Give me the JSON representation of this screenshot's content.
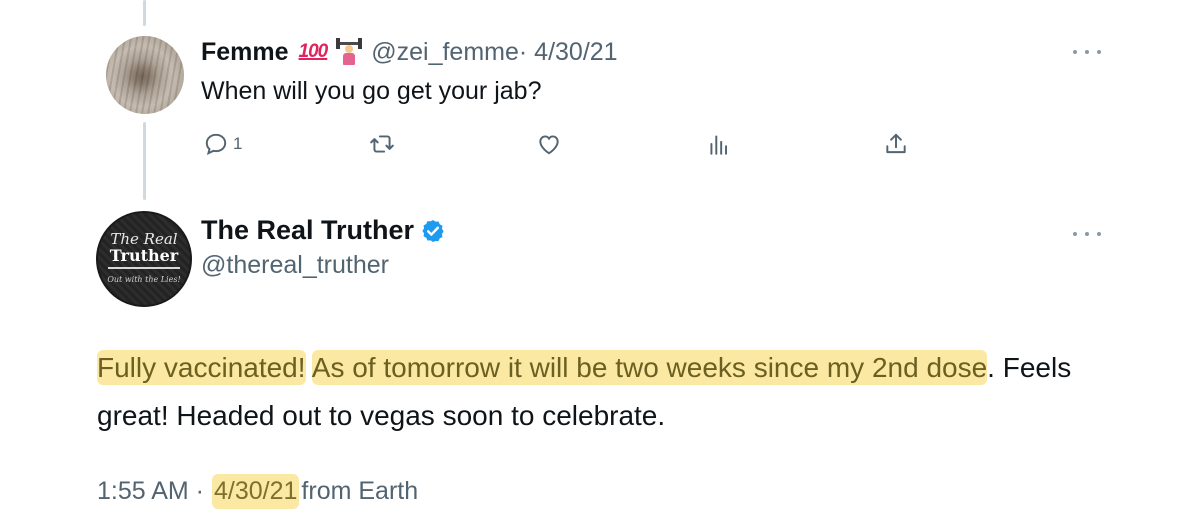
{
  "reply": {
    "display_name": "Femme",
    "emoji_badges": [
      "100-emoji",
      "weightlifter-emoji"
    ],
    "emoji_100_text": "100",
    "handle": "@zei_femme",
    "date": "· 4/30/21",
    "text": "When will you go get your jab?",
    "actions": {
      "reply_count": "1",
      "retweet_count": "",
      "like_count": "",
      "views_count": ""
    }
  },
  "main": {
    "display_name": "The Real Truther",
    "verified": true,
    "handle": "@thereal_truther",
    "avatar_text": {
      "line1": "The Real",
      "line2": "Truther",
      "line3": "Out with the Lies!"
    },
    "text_segments": [
      {
        "text": "Fully vaccinated!",
        "highlighted": true
      },
      {
        "text": " ",
        "highlighted": false
      },
      {
        "text": "As of tomorrow it will be two weeks since my 2nd dose",
        "highlighted": true
      },
      {
        "text": ". Feels great! Headed out to vegas soon to celebrate.",
        "highlighted": false
      }
    ],
    "time": "1:55 AM ·",
    "date": "4/30/21",
    "source": "from Earth"
  },
  "colors": {
    "text_primary": "#0f1419",
    "text_secondary": "#536471",
    "highlight": "#fbe9a3",
    "verified_blue": "#1d9bf0",
    "thread_line": "#cfd9de"
  },
  "icons": [
    "reply-icon",
    "retweet-icon",
    "like-icon",
    "views-icon",
    "share-icon",
    "more-icon",
    "verified-badge-icon"
  ]
}
